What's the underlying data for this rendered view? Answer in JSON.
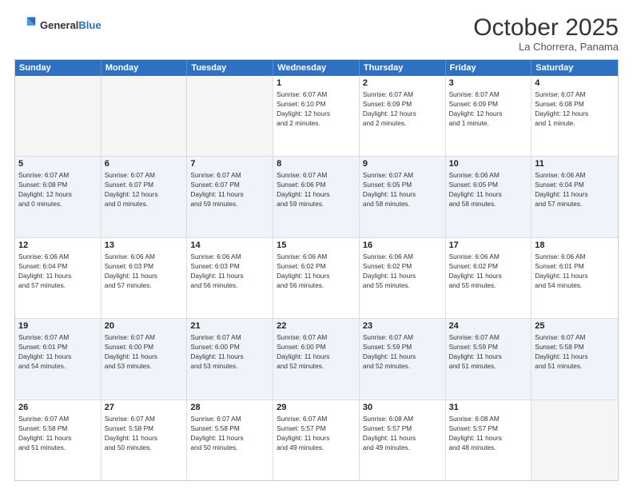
{
  "header": {
    "logo_general": "General",
    "logo_blue": "Blue",
    "month": "October 2025",
    "location": "La Chorrera, Panama"
  },
  "days": [
    "Sunday",
    "Monday",
    "Tuesday",
    "Wednesday",
    "Thursday",
    "Friday",
    "Saturday"
  ],
  "rows": [
    [
      {
        "day": "",
        "lines": [],
        "empty": true
      },
      {
        "day": "",
        "lines": [],
        "empty": true
      },
      {
        "day": "",
        "lines": [],
        "empty": true
      },
      {
        "day": "1",
        "lines": [
          "Sunrise: 6:07 AM",
          "Sunset: 6:10 PM",
          "Daylight: 12 hours",
          "and 2 minutes."
        ]
      },
      {
        "day": "2",
        "lines": [
          "Sunrise: 6:07 AM",
          "Sunset: 6:09 PM",
          "Daylight: 12 hours",
          "and 2 minutes."
        ]
      },
      {
        "day": "3",
        "lines": [
          "Sunrise: 6:07 AM",
          "Sunset: 6:09 PM",
          "Daylight: 12 hours",
          "and 1 minute."
        ]
      },
      {
        "day": "4",
        "lines": [
          "Sunrise: 6:07 AM",
          "Sunset: 6:08 PM",
          "Daylight: 12 hours",
          "and 1 minute."
        ]
      }
    ],
    [
      {
        "day": "5",
        "lines": [
          "Sunrise: 6:07 AM",
          "Sunset: 6:08 PM",
          "Daylight: 12 hours",
          "and 0 minutes."
        ]
      },
      {
        "day": "6",
        "lines": [
          "Sunrise: 6:07 AM",
          "Sunset: 6:07 PM",
          "Daylight: 12 hours",
          "and 0 minutes."
        ]
      },
      {
        "day": "7",
        "lines": [
          "Sunrise: 6:07 AM",
          "Sunset: 6:07 PM",
          "Daylight: 11 hours",
          "and 59 minutes."
        ]
      },
      {
        "day": "8",
        "lines": [
          "Sunrise: 6:07 AM",
          "Sunset: 6:06 PM",
          "Daylight: 11 hours",
          "and 59 minutes."
        ]
      },
      {
        "day": "9",
        "lines": [
          "Sunrise: 6:07 AM",
          "Sunset: 6:05 PM",
          "Daylight: 11 hours",
          "and 58 minutes."
        ]
      },
      {
        "day": "10",
        "lines": [
          "Sunrise: 6:06 AM",
          "Sunset: 6:05 PM",
          "Daylight: 11 hours",
          "and 58 minutes."
        ]
      },
      {
        "day": "11",
        "lines": [
          "Sunrise: 6:06 AM",
          "Sunset: 6:04 PM",
          "Daylight: 11 hours",
          "and 57 minutes."
        ]
      }
    ],
    [
      {
        "day": "12",
        "lines": [
          "Sunrise: 6:06 AM",
          "Sunset: 6:04 PM",
          "Daylight: 11 hours",
          "and 57 minutes."
        ]
      },
      {
        "day": "13",
        "lines": [
          "Sunrise: 6:06 AM",
          "Sunset: 6:03 PM",
          "Daylight: 11 hours",
          "and 57 minutes."
        ]
      },
      {
        "day": "14",
        "lines": [
          "Sunrise: 6:06 AM",
          "Sunset: 6:03 PM",
          "Daylight: 11 hours",
          "and 56 minutes."
        ]
      },
      {
        "day": "15",
        "lines": [
          "Sunrise: 6:06 AM",
          "Sunset: 6:02 PM",
          "Daylight: 11 hours",
          "and 56 minutes."
        ]
      },
      {
        "day": "16",
        "lines": [
          "Sunrise: 6:06 AM",
          "Sunset: 6:02 PM",
          "Daylight: 11 hours",
          "and 55 minutes."
        ]
      },
      {
        "day": "17",
        "lines": [
          "Sunrise: 6:06 AM",
          "Sunset: 6:02 PM",
          "Daylight: 11 hours",
          "and 55 minutes."
        ]
      },
      {
        "day": "18",
        "lines": [
          "Sunrise: 6:06 AM",
          "Sunset: 6:01 PM",
          "Daylight: 11 hours",
          "and 54 minutes."
        ]
      }
    ],
    [
      {
        "day": "19",
        "lines": [
          "Sunrise: 6:07 AM",
          "Sunset: 6:01 PM",
          "Daylight: 11 hours",
          "and 54 minutes."
        ]
      },
      {
        "day": "20",
        "lines": [
          "Sunrise: 6:07 AM",
          "Sunset: 6:00 PM",
          "Daylight: 11 hours",
          "and 53 minutes."
        ]
      },
      {
        "day": "21",
        "lines": [
          "Sunrise: 6:07 AM",
          "Sunset: 6:00 PM",
          "Daylight: 11 hours",
          "and 53 minutes."
        ]
      },
      {
        "day": "22",
        "lines": [
          "Sunrise: 6:07 AM",
          "Sunset: 6:00 PM",
          "Daylight: 11 hours",
          "and 52 minutes."
        ]
      },
      {
        "day": "23",
        "lines": [
          "Sunrise: 6:07 AM",
          "Sunset: 5:59 PM",
          "Daylight: 11 hours",
          "and 52 minutes."
        ]
      },
      {
        "day": "24",
        "lines": [
          "Sunrise: 6:07 AM",
          "Sunset: 5:59 PM",
          "Daylight: 11 hours",
          "and 51 minutes."
        ]
      },
      {
        "day": "25",
        "lines": [
          "Sunrise: 6:07 AM",
          "Sunset: 5:58 PM",
          "Daylight: 11 hours",
          "and 51 minutes."
        ]
      }
    ],
    [
      {
        "day": "26",
        "lines": [
          "Sunrise: 6:07 AM",
          "Sunset: 5:58 PM",
          "Daylight: 11 hours",
          "and 51 minutes."
        ]
      },
      {
        "day": "27",
        "lines": [
          "Sunrise: 6:07 AM",
          "Sunset: 5:58 PM",
          "Daylight: 11 hours",
          "and 50 minutes."
        ]
      },
      {
        "day": "28",
        "lines": [
          "Sunrise: 6:07 AM",
          "Sunset: 5:58 PM",
          "Daylight: 11 hours",
          "and 50 minutes."
        ]
      },
      {
        "day": "29",
        "lines": [
          "Sunrise: 6:07 AM",
          "Sunset: 5:57 PM",
          "Daylight: 11 hours",
          "and 49 minutes."
        ]
      },
      {
        "day": "30",
        "lines": [
          "Sunrise: 6:08 AM",
          "Sunset: 5:57 PM",
          "Daylight: 11 hours",
          "and 49 minutes."
        ]
      },
      {
        "day": "31",
        "lines": [
          "Sunrise: 6:08 AM",
          "Sunset: 5:57 PM",
          "Daylight: 11 hours",
          "and 48 minutes."
        ]
      },
      {
        "day": "",
        "lines": [],
        "empty": true
      }
    ]
  ]
}
